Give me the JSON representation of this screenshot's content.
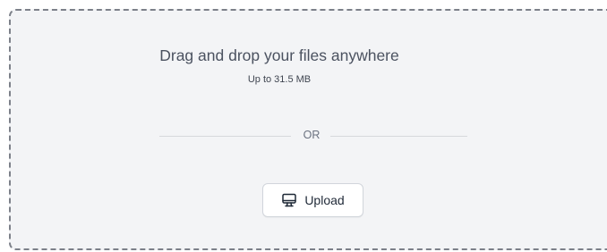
{
  "dropzone": {
    "title": "Drag and drop your files anywhere",
    "subtitle": "Up to 31.5 MB",
    "divider_text": "OR",
    "upload_button": {
      "label": "Upload",
      "icon": "computer-icon"
    }
  },
  "colors": {
    "background": "#f3f4f6",
    "border": "#7c8089",
    "title_text": "#4b5260",
    "button_bg": "#ffffff",
    "button_border": "#d1d5db"
  }
}
